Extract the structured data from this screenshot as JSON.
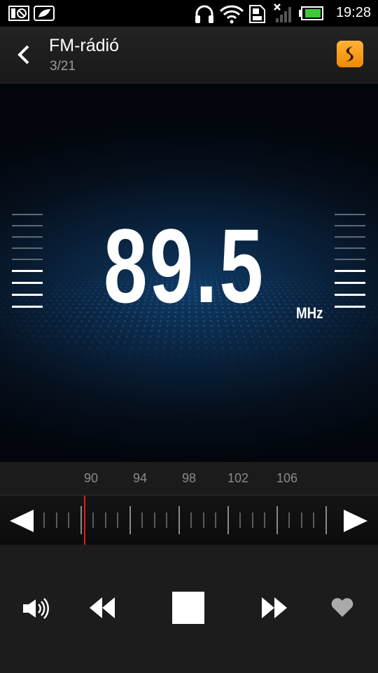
{
  "status_bar": {
    "time": "19:28",
    "icons": [
      "no-sim-icon",
      "leaf-icon",
      "headset-icon",
      "wifi-icon",
      "sd-card-icon",
      "signal-off-icon",
      "battery-icon"
    ]
  },
  "header": {
    "title": "FM-rádió",
    "subtitle": "3/21",
    "back_icon": "chevron-left-icon",
    "app_icon": "soundhound-icon"
  },
  "display": {
    "frequency": "89.5",
    "unit": "MHz"
  },
  "scale": {
    "labels": [
      "90",
      "94",
      "98",
      "102",
      "106"
    ]
  },
  "controls": {
    "icons": [
      "volume-icon",
      "seek-back-icon",
      "stop-icon",
      "seek-forward-icon",
      "favorite-heart-icon"
    ]
  },
  "colors": {
    "needle": "#e0201c",
    "accent": "#f5a21a"
  }
}
